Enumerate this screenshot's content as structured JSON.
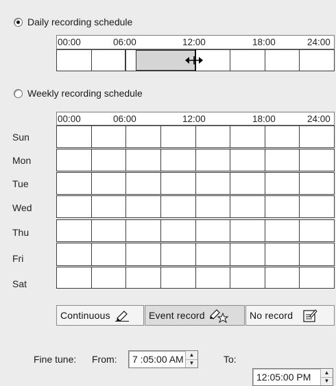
{
  "daily": {
    "label": "Daily recording schedule",
    "selected": true,
    "times": [
      "00:00",
      "06:00",
      "12:00",
      "18:00",
      "24:00"
    ]
  },
  "weekly": {
    "label": "Weekly recording schedule",
    "selected": false,
    "times": [
      "00:00",
      "06:00",
      "12:00",
      "18:00",
      "24:00"
    ],
    "days": [
      "Sun",
      "Mon",
      "Tue",
      "Wed",
      "Thu",
      "Fri",
      "Sat"
    ]
  },
  "legend": {
    "continuous": "Continuous",
    "event": "Event record",
    "none": "No record"
  },
  "finetune": {
    "label": "Fine tune:",
    "from_label": "From:",
    "from_value": "7 :05:00 AM",
    "to_label": "To:",
    "to_value": "12:05:00 PM"
  },
  "icons": {
    "continuous": "pencil-icon",
    "event": "pencil-star-icon",
    "none": "no-record-icon",
    "resize": "resize-horizontal-icon"
  }
}
